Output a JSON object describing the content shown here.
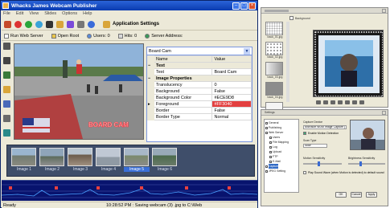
{
  "main_window": {
    "title": "Whacks James Webcam Publisher",
    "menu": [
      "File",
      "Edit",
      "View",
      "Slides",
      "Options",
      "Help"
    ],
    "app_settings_label": "Application Settings",
    "toolbar2": {
      "run_web_server": "Run Web Server",
      "open_root": "Open Root",
      "users": "Users: 0",
      "hits": "Hits: 0",
      "server_address": "Server Address:"
    },
    "overlay_text": "BOARD CAM",
    "overlay_color": "#ECE9D8",
    "overlay_border": "#FF3040"
  },
  "properties": {
    "selected_object": "Board Cam",
    "columns": [
      "Name",
      "Value"
    ],
    "categories": {
      "text": "Text",
      "image_properties": "Image Properties"
    },
    "text_rows": [
      {
        "name": "Text",
        "value": "Board Cam"
      }
    ],
    "image_rows": [
      {
        "name": "Translucency",
        "value": "0"
      },
      {
        "name": "Background",
        "value": "False"
      },
      {
        "name": "Background Color",
        "value": "#ECE9D8"
      },
      {
        "name": "Foreground",
        "value": "#FF3040"
      },
      {
        "name": "Border",
        "value": "False"
      },
      {
        "name": "Border Type",
        "value": "Normal"
      }
    ]
  },
  "thumbnails": [
    {
      "caption": "Image 1",
      "selected": false
    },
    {
      "caption": "Image 2",
      "selected": false
    },
    {
      "caption": "Image 3",
      "selected": false
    },
    {
      "caption": "Image 4",
      "selected": false
    },
    {
      "caption": "Image 5",
      "selected": true
    },
    {
      "caption": "Image 6",
      "selected": false
    }
  ],
  "status": {
    "ready": "Ready",
    "message": "10:28:52 PM :  Saving webcam (3) .jpg to C:\\Web"
  },
  "background_window": {
    "checkbox_label": "Background",
    "items": [
      "back_01.jpg",
      "back_02.jpg",
      "back_03.jpg",
      "back_04.jpg",
      ""
    ]
  },
  "settings_window": {
    "title": "Settings",
    "tree": [
      {
        "label": "General",
        "level": 0,
        "selected": false
      },
      {
        "label": "Publishing",
        "level": 0,
        "selected": false
      },
      {
        "label": "Web Server",
        "level": 0,
        "selected": false
      },
      {
        "label": "Users",
        "level": 1,
        "selected": false
      },
      {
        "label": "File Mapping",
        "level": 1,
        "selected": false
      },
      {
        "label": "Log",
        "level": 1,
        "selected": false
      },
      {
        "label": "Upload",
        "level": 1,
        "selected": false
      },
      {
        "label": "FTP",
        "level": 1,
        "selected": false
      },
      {
        "label": "E-Mail",
        "level": 1,
        "selected": false
      },
      {
        "label": "Capture",
        "level": 0,
        "selected": true
      },
      {
        "label": "JPEG Setting",
        "level": 0,
        "selected": false
      }
    ],
    "capture_device_label": "Capture Device",
    "capture_device_value": "Microsoft WDM Image Capture (",
    "enable_motion": "Enable Motion Detection",
    "scan_type_label": "Scan Type",
    "scan_type_value": "Slow",
    "motion_sensitivity": "Motion Sensitivity",
    "brightness_sensitivity": "Brightness Sensitivity",
    "play_sound": "Play Sound Wave (when Motion is detected) to default sound",
    "buttons": [
      "OK",
      "Cancel",
      "Apply"
    ]
  }
}
